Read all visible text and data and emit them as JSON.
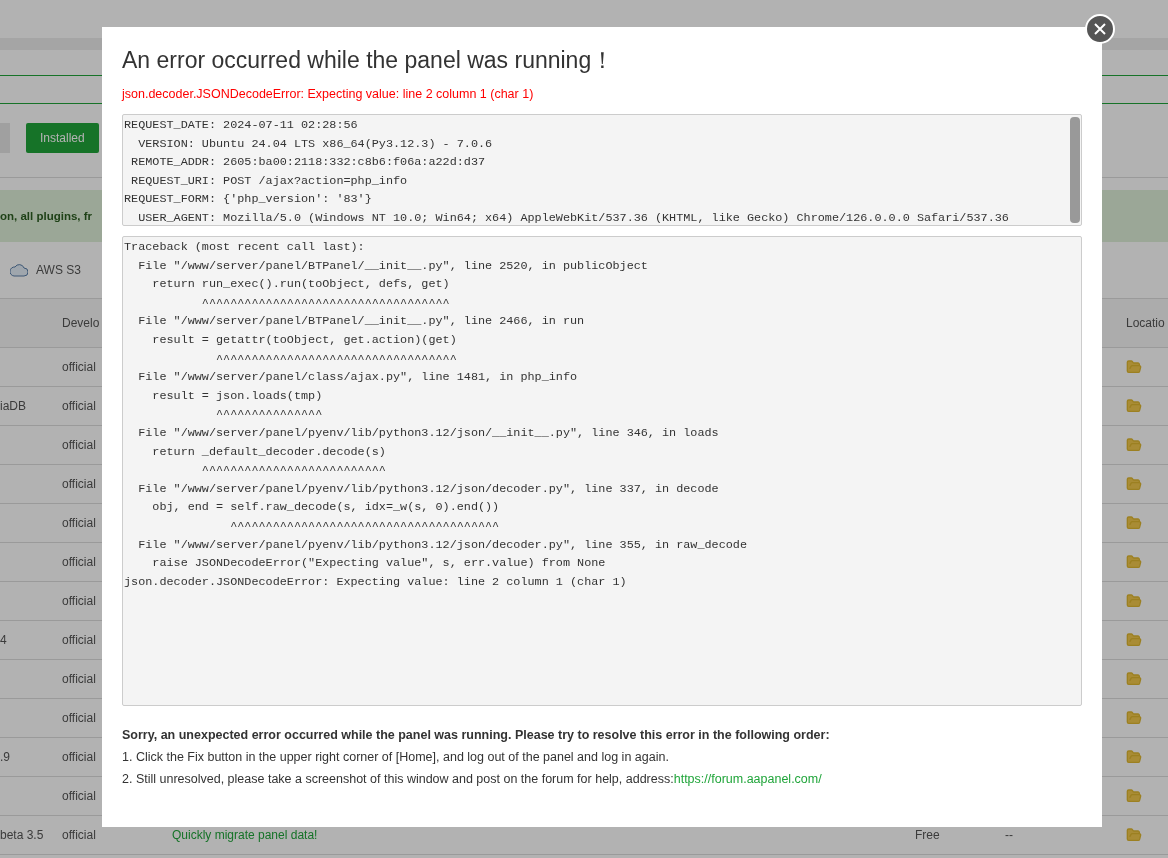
{
  "background": {
    "installed_button": "Installed",
    "notice": "on, all plugins, fr",
    "storage_tab": "AWS S3",
    "columns": {
      "developer": "Develo",
      "location": "Locatio"
    },
    "rows": [
      {
        "developer": "official"
      },
      {
        "name": "iaDB",
        "developer": "official"
      },
      {
        "developer": "official"
      },
      {
        "developer": "official"
      },
      {
        "developer": "official"
      },
      {
        "developer": "official"
      },
      {
        "developer": "official"
      },
      {
        "name": "4",
        "developer": "official"
      },
      {
        "developer": "official"
      },
      {
        "developer": "official"
      },
      {
        "name": ".9",
        "developer": "official"
      },
      {
        "developer": "official"
      },
      {
        "name": "beta 3.5",
        "developer": "official",
        "description": "Quickly migrate panel data!",
        "price": "Free",
        "column_5": "--"
      }
    ]
  },
  "dialog": {
    "title": "An error occurred while the panel was running！",
    "error": "json.decoder.JSONDecodeError: Expecting value: line 2 column 1 (char 1)",
    "request_info": [
      "REQUEST_DATE: 2024-07-11 02:28:56",
      "  VERSION: Ubuntu 24.04 LTS x86_64(Py3.12.3) - 7.0.6",
      " REMOTE_ADDR: 2605:ba00:2118:332:c8b6:f06a:a22d:d37",
      " REQUEST_URI: POST /ajax?action=php_info",
      "REQUEST_FORM: {'php_version': '83'}",
      "  USER_AGENT: Mozilla/5.0 (Windows NT 10.0; Win64; x64) AppleWebKit/537.36 (KHTML, like Gecko) Chrome/126.0.0.0 Safari/537.36"
    ],
    "traceback": [
      "Traceback (most recent call last):",
      "  File \"/www/server/panel/BTPanel/__init__.py\", line 2520, in publicObject",
      "    return run_exec().run(toObject, defs, get)",
      "           ^^^^^^^^^^^^^^^^^^^^^^^^^^^^^^^^^^^",
      "  File \"/www/server/panel/BTPanel/__init__.py\", line 2466, in run",
      "    result = getattr(toObject, get.action)(get)",
      "             ^^^^^^^^^^^^^^^^^^^^^^^^^^^^^^^^^^",
      "  File \"/www/server/panel/class/ajax.py\", line 1481, in php_info",
      "    result = json.loads(tmp)",
      "             ^^^^^^^^^^^^^^^",
      "  File \"/www/server/panel/pyenv/lib/python3.12/json/__init__.py\", line 346, in loads",
      "    return _default_decoder.decode(s)",
      "           ^^^^^^^^^^^^^^^^^^^^^^^^^^",
      "  File \"/www/server/panel/pyenv/lib/python3.12/json/decoder.py\", line 337, in decode",
      "    obj, end = self.raw_decode(s, idx=_w(s, 0).end())",
      "               ^^^^^^^^^^^^^^^^^^^^^^^^^^^^^^^^^^^^^^",
      "  File \"/www/server/panel/pyenv/lib/python3.12/json/decoder.py\", line 355, in raw_decode",
      "    raise JSONDecodeError(\"Expecting value\", s, err.value) from None",
      "json.decoder.JSONDecodeError: Expecting value: line 2 column 1 (char 1)"
    ],
    "help_heading": "Sorry, an unexpected error occurred while the panel was running. Please try to resolve this error in the following order:",
    "steps": [
      {
        "text": "1. Click the Fix button in the upper right corner of [Home], and log out of the panel and log in again."
      },
      {
        "text": "2. Still unresolved, please take a screenshot of this window and post on the forum for help, address:",
        "link": "https://forum.aapanel.com/"
      }
    ]
  }
}
